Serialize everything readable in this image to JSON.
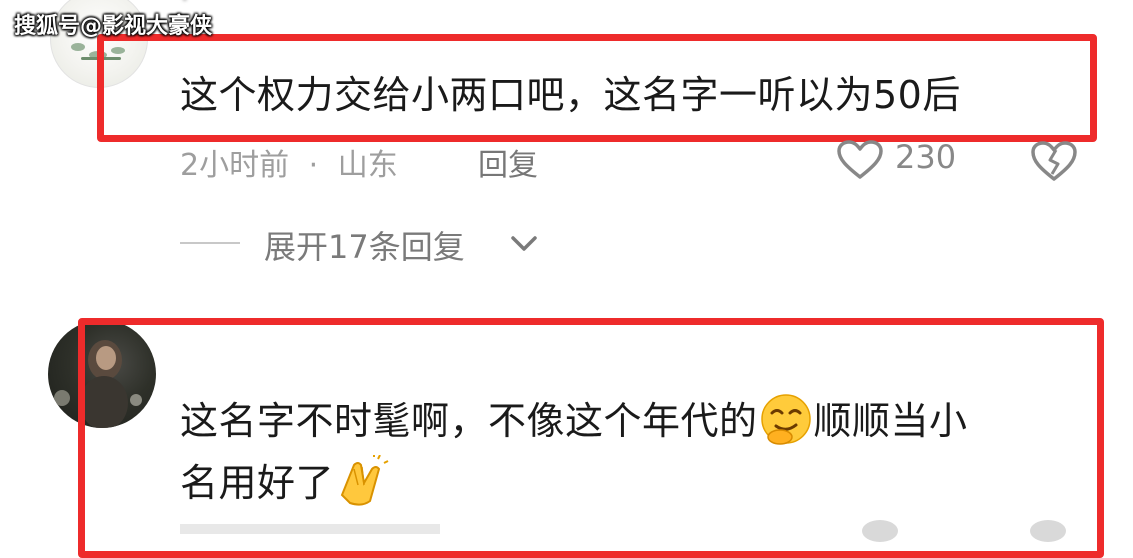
{
  "watermark": "搜狐号@影视大豪侠",
  "comments": [
    {
      "name": "·",
      "text": "这个权力交给小两口吧，这名字一听以为50后",
      "time": "2小时前",
      "separator": "·",
      "location": "山东",
      "reply_label": "回复",
      "likes": "230"
    },
    {
      "name": "",
      "text_line1": "这名字不时髦啊，不像这个年代的",
      "text_line1_end": "顺顺当小",
      "text_line2": "名用好了"
    }
  ],
  "expand": {
    "label": "展开17条回复"
  },
  "colors": {
    "highlight_border": "#ee2b2b",
    "muted_text": "#9e9e9e",
    "body_text": "#1a1a1a"
  },
  "icons": [
    "heart-outline-icon",
    "broken-heart-icon",
    "chevron-down-icon",
    "smirk-emoji-icon",
    "clapping-hands-emoji-icon"
  ]
}
